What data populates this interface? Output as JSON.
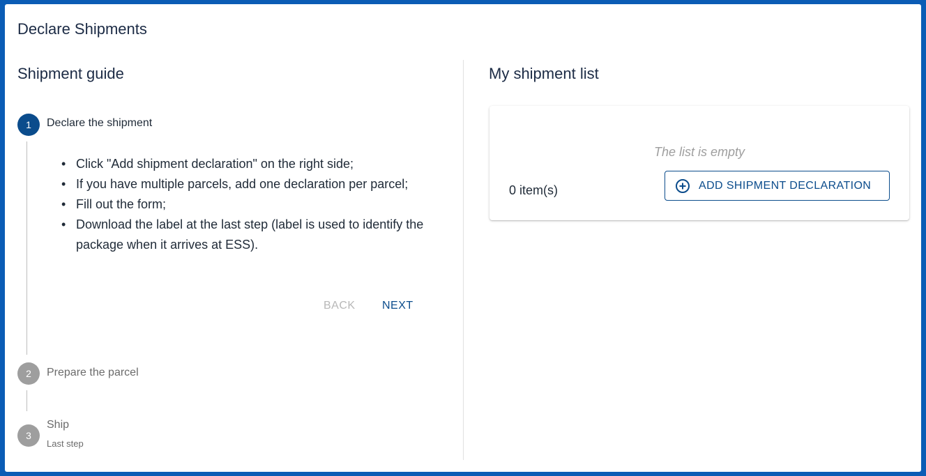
{
  "page": {
    "title": "Declare Shipments"
  },
  "guide": {
    "title": "Shipment guide",
    "steps": [
      {
        "number": "1",
        "label": "Declare the shipment",
        "state": "active"
      },
      {
        "number": "2",
        "label": "Prepare the parcel",
        "state": "inactive"
      },
      {
        "number": "3",
        "label": "Ship",
        "sublabel": "Last step",
        "state": "inactive"
      }
    ],
    "instructions": [
      "Click \"Add shipment declaration\" on the right side;",
      "If you have multiple parcels, add one declaration per parcel;",
      "Fill out the form;",
      "Download the label at the last step (label is used to identify the package when it arrives at ESS)."
    ],
    "back_label": "BACK",
    "next_label": "NEXT"
  },
  "shipment_list": {
    "title": "My shipment list",
    "empty_message": "The list is empty",
    "count_label": "0 item(s)",
    "add_button_label": "ADD SHIPMENT DECLARATION",
    "add_button_icon": "plus-circle-icon"
  },
  "colors": {
    "background_frame": "#0b5cb5",
    "primary": "#0b4c8c",
    "inactive_step": "#9e9e9e",
    "disabled_text": "#b8b8b8"
  }
}
